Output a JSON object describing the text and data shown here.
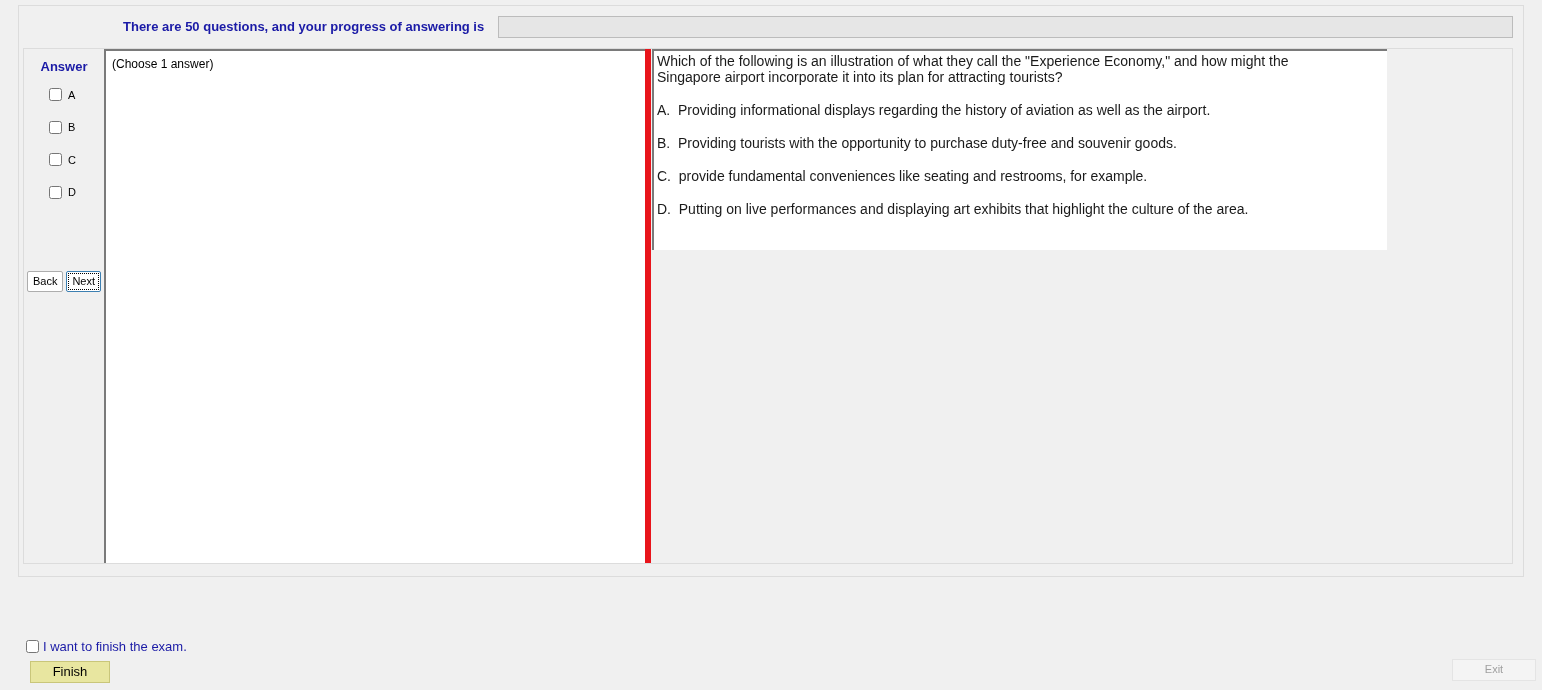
{
  "header": {
    "progress_label": "There are 50 questions, and your progress of answering is",
    "progress": {
      "level": 0
    }
  },
  "answer_panel": {
    "title": "Answer",
    "options": [
      {
        "label": "A",
        "checked": false
      },
      {
        "label": "B",
        "checked": false
      },
      {
        "label": "C",
        "checked": false
      },
      {
        "label": "D",
        "checked": false
      }
    ],
    "buttons": [
      {
        "label": "Back",
        "focused": false
      },
      {
        "label": "Next",
        "focused": true
      }
    ]
  },
  "answer_box": {
    "hint": "(Choose 1 answer)"
  },
  "question": {
    "text": "Which of the following is an illustration of what they call the \"Experience Economy,\" and how might the Singapore airport incorporate it into its plan for attracting tourists?",
    "choices": [
      "A.  Providing informational displays regarding the history of aviation as well as the airport.",
      "B.  Providing tourists with the opportunity to purchase duty-free and souvenir goods.",
      "C.  provide fundamental conveniences like seating and restrooms, for example.",
      "D.  Putting on live performances and displaying art exhibits that highlight the culture of the area."
    ]
  },
  "footer": {
    "finish_check": {
      "label": "I want to finish the exam.",
      "checked": false
    },
    "finish_button": "Finish",
    "exit_button": {
      "label": "Exit",
      "disabled": true
    }
  }
}
